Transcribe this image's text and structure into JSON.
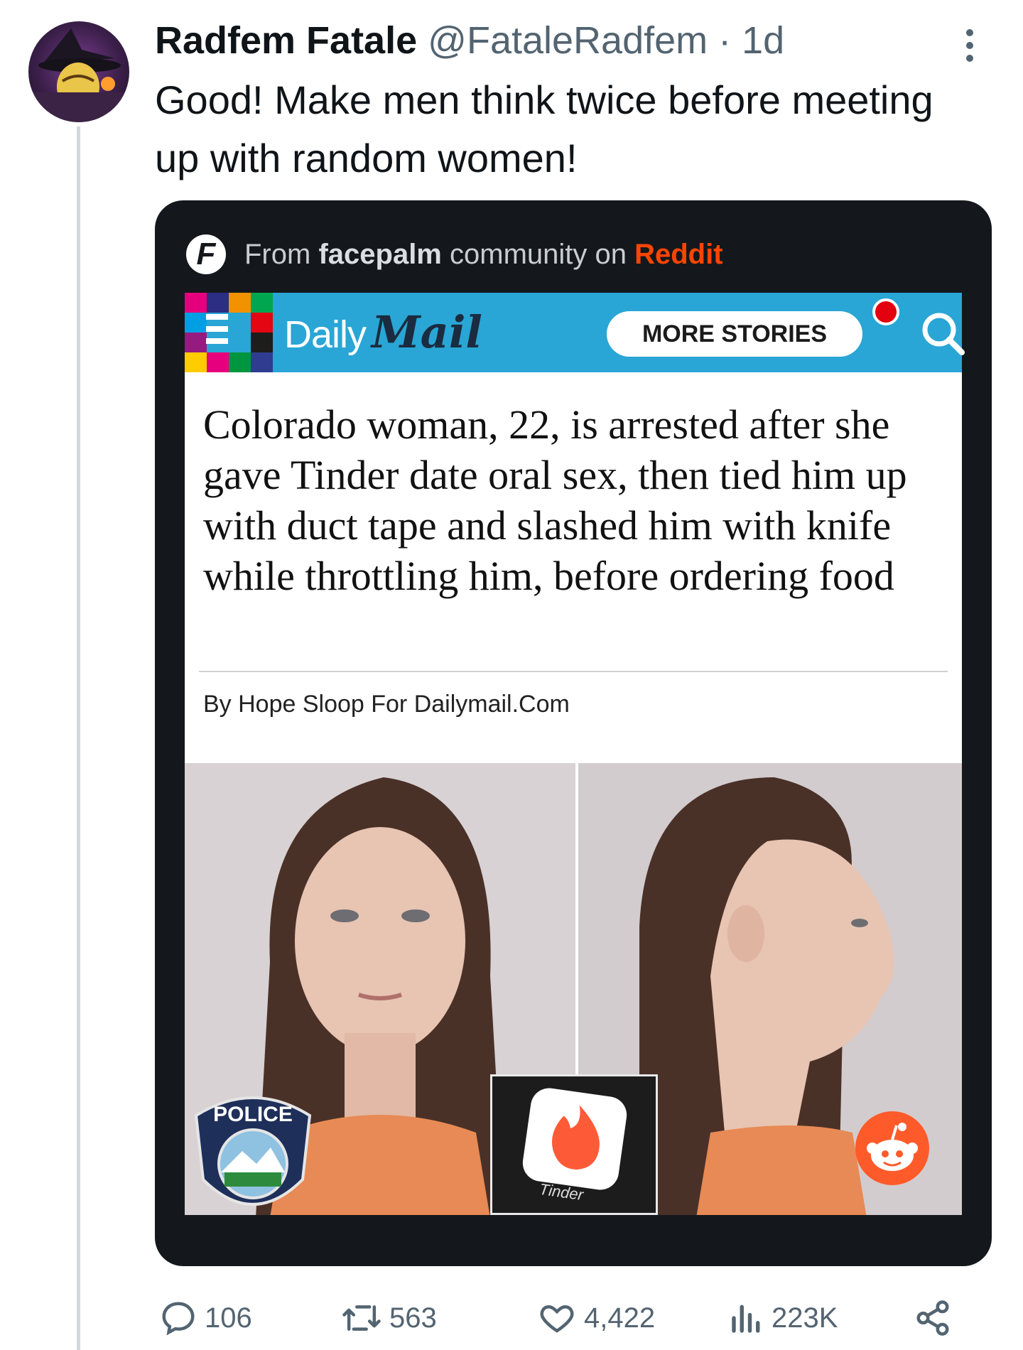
{
  "tweet": {
    "display_name": "Radfem Fatale",
    "handle": "@FataleRadfem",
    "separator": "·",
    "time": "1d",
    "text": "Good! Make men think twice before meeting up with random women!"
  },
  "embed": {
    "source_prefix": "From",
    "community": "facepalm",
    "source_middle": "community on",
    "platform": "Reddit",
    "f_logo_letter": "F"
  },
  "dailymail": {
    "logo_daily": "Daily",
    "logo_mail": "Mail",
    "more_stories_label": "MORE STORIES",
    "headline": "Colorado woman, 22, is arrested after she gave Tinder date oral sex, then tied him up with duct tape and slashed him with knife while throttling him, before ordering food",
    "byline": "By Hope Sloop For Dailymail.Com",
    "police_badge_text": "POLICE",
    "tinder_label": "Tinder"
  },
  "actions": {
    "replies": "106",
    "reposts": "563",
    "likes": "4,422",
    "views": "223K"
  },
  "icons": {
    "reply": "reply-icon",
    "repost": "repost-icon",
    "like": "heart-icon",
    "views": "views-icon",
    "share": "share-icon",
    "more": "more-vertical-icon"
  },
  "colors": {
    "reddit_orange": "#ff4500",
    "dailymail_blue": "#29a6d5",
    "secondary_text": "#536471"
  }
}
